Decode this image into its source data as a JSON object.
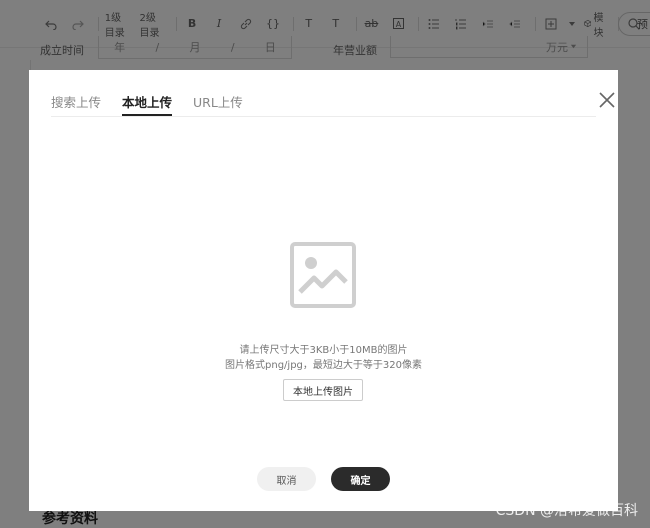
{
  "toolbar": {
    "heading1": "1级目录",
    "heading2": "2级目录",
    "bold": "B",
    "italic": "I",
    "code": "{}",
    "superscript": "T",
    "subscript": "T",
    "strike": "ab",
    "textbox": "A",
    "module": "模块",
    "preview": "预"
  },
  "form": {
    "date_label": "成立时间",
    "year": "年",
    "month": "月",
    "day": "日",
    "sep1": "/",
    "sep2": "/",
    "revenue_label": "年营业额",
    "revenue_unit": "万元"
  },
  "dialog": {
    "tabs": [
      "搜索上传",
      "本地上传",
      "URL上传"
    ],
    "active_tab": "本地上传",
    "hint_size": "请上传尺寸大于3KB小于10MB的图片",
    "hint_format": "图片格式png/jpg，最短边大于等于320像素",
    "upload_button": "本地上传图片",
    "cancel_button": "取消",
    "confirm_button": "确定"
  },
  "background": {
    "references_heading": "参考资料"
  },
  "watermark": "CSDN @洛希爱做百科"
}
